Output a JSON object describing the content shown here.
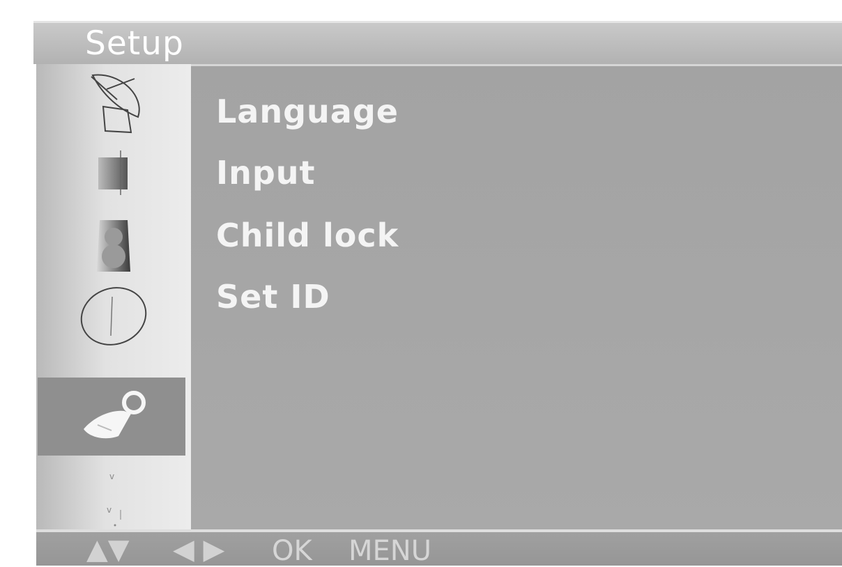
{
  "header": {
    "title": "Setup"
  },
  "sidebar": {
    "icons": [
      {
        "name": "satellite-dish-icon",
        "selected": false
      },
      {
        "name": "picture-icon",
        "selected": false
      },
      {
        "name": "speaker-icon",
        "selected": false
      },
      {
        "name": "clock-icon",
        "selected": false
      },
      {
        "name": "wrench-icon",
        "selected": true
      },
      {
        "name": "more-icon",
        "selected": false
      }
    ]
  },
  "menu": {
    "items": [
      {
        "label": "Language"
      },
      {
        "label": "Input"
      },
      {
        "label": "Child lock"
      },
      {
        "label": "Set ID"
      }
    ]
  },
  "footer": {
    "nav_up_down": "▲▼",
    "nav_left_right": "◀ ▶",
    "ok_label": "OK",
    "menu_label": "MENU"
  },
  "colors": {
    "title_bar": "#bdbdbd",
    "content_bg": "#a6a6a6",
    "sidebar_selected": "#8f8f8f",
    "text": "#f4f4f4"
  }
}
